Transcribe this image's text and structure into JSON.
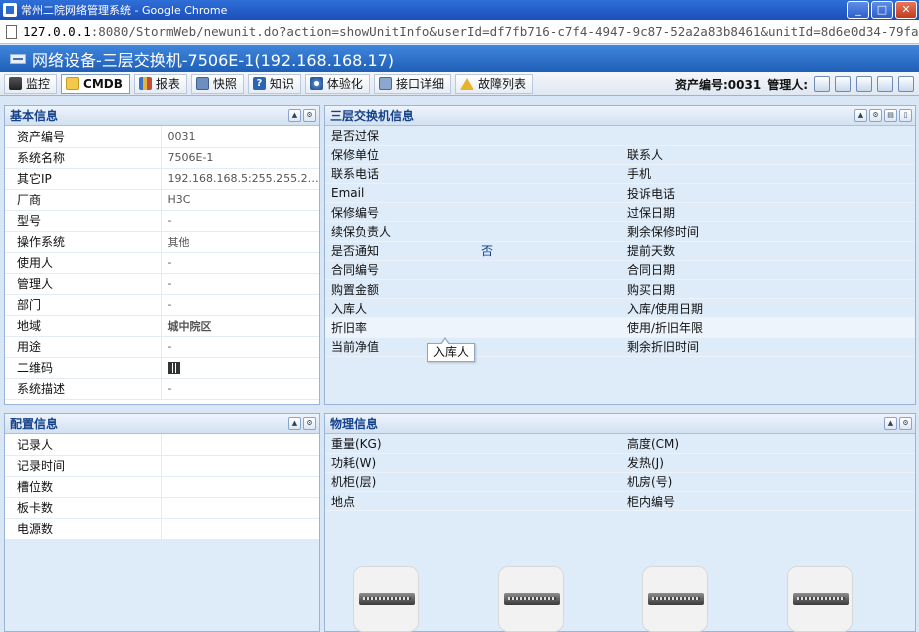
{
  "window": {
    "title": "常州二院网络管理系统 - Google Chrome"
  },
  "address": {
    "host": "127.0.0.1",
    "rest": ":8080/StormWeb/newunit.do?action=showUnitInfo&userId=df7fb716-c7f4-4947-9c87-52a2a83b8461&unitId=8d6e0d34-79fa-48"
  },
  "page": {
    "title": "网络设备-三层交换机-7506E-1(192.168.168.17)"
  },
  "tabs": [
    {
      "label": "监控",
      "icon": "monitor-icon"
    },
    {
      "label": "CMDB",
      "icon": "cmdb-icon"
    },
    {
      "label": "报表",
      "icon": "report-icon"
    },
    {
      "label": "快照",
      "icon": "snapshot-icon"
    },
    {
      "label": "知识",
      "icon": "knowledge-icon"
    },
    {
      "label": "体验化",
      "icon": "experience-icon"
    },
    {
      "label": "接口详细",
      "icon": "port-icon"
    },
    {
      "label": "故障列表",
      "icon": "warning-icon"
    }
  ],
  "header_right": {
    "asset_no": "资产编号:0031",
    "manager": "管理人:"
  },
  "basic": {
    "title": "基本信息",
    "rows": [
      {
        "k": "资产编号",
        "v": "0031"
      },
      {
        "k": "系统名称",
        "v": "7506E-1"
      },
      {
        "k": "其它IP",
        "v": "192.168.168.5:255.255.255..."
      },
      {
        "k": "厂商",
        "v": "H3C"
      },
      {
        "k": "型号",
        "v": "-"
      },
      {
        "k": "操作系统",
        "v": "其他"
      },
      {
        "k": "使用人",
        "v": "-"
      },
      {
        "k": "管理人",
        "v": "-"
      },
      {
        "k": "部门",
        "v": "-"
      },
      {
        "k": "地域",
        "v": "城中院区"
      },
      {
        "k": "用途",
        "v": "-"
      },
      {
        "k": "二维码",
        "v": ""
      },
      {
        "k": "系统描述",
        "v": "-"
      }
    ]
  },
  "switch": {
    "title": "三层交换机信息",
    "rows": [
      [
        "是否过保",
        "",
        "",
        ""
      ],
      [
        "保修单位",
        "",
        "联系人",
        ""
      ],
      [
        "联系电话",
        "",
        "手机",
        ""
      ],
      [
        "Email",
        "",
        "投诉电话",
        ""
      ],
      [
        "保修编号",
        "",
        "过保日期",
        ""
      ],
      [
        "续保负责人",
        "",
        "剩余保修时间",
        ""
      ],
      [
        "是否通知",
        "否",
        "提前天数",
        ""
      ],
      [
        "合同编号",
        "",
        "合同日期",
        ""
      ],
      [
        "购置金额",
        "",
        "购买日期",
        ""
      ],
      [
        "入库人",
        "",
        "入库/使用日期",
        ""
      ],
      [
        "折旧率",
        "",
        "使用/折旧年限",
        ""
      ],
      [
        "当前净值",
        "",
        "剩余折旧时间",
        ""
      ]
    ],
    "tooltip": "入库人"
  },
  "config": {
    "title": "配置信息",
    "rows": [
      {
        "k": "记录人",
        "v": ""
      },
      {
        "k": "记录时间",
        "v": ""
      },
      {
        "k": "槽位数",
        "v": ""
      },
      {
        "k": "板卡数",
        "v": ""
      },
      {
        "k": "电源数",
        "v": ""
      }
    ]
  },
  "physical": {
    "title": "物理信息",
    "rows": [
      [
        "重量(KG)",
        "",
        "高度(CM)",
        ""
      ],
      [
        "功耗(W)",
        "",
        "发热(J)",
        ""
      ],
      [
        "机柜(层)",
        "",
        "机房(号)",
        ""
      ],
      [
        "地点",
        "",
        "柜内编号",
        ""
      ]
    ]
  }
}
